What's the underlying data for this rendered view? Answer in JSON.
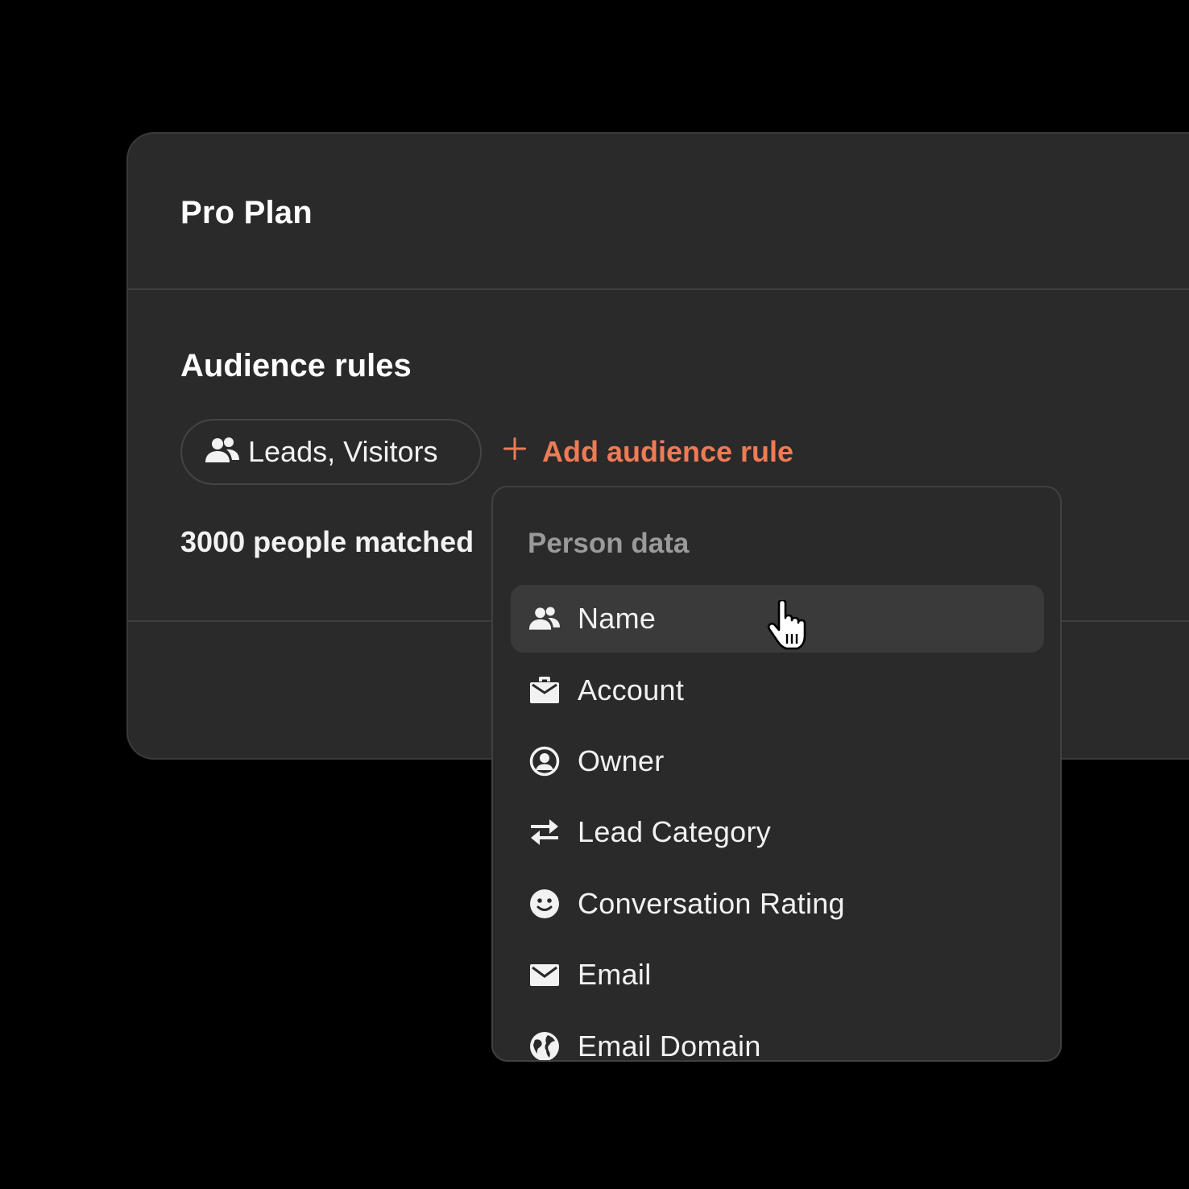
{
  "card": {
    "title": "Pro Plan",
    "section_title": "Audience rules",
    "audience_chip": {
      "icon": "people-icon",
      "label": "Leads, Visitors"
    },
    "add_rule_label": "Add audience rule",
    "matched_text": "3000 people matched"
  },
  "dropdown": {
    "header": "Person data",
    "items": [
      {
        "label": "Name",
        "icon": "people-icon",
        "active": true
      },
      {
        "label": "Account",
        "icon": "briefcase-icon",
        "active": false
      },
      {
        "label": "Owner",
        "icon": "user-circle-icon",
        "active": false
      },
      {
        "label": "Lead Category",
        "icon": "swap-arrows-icon",
        "active": false
      },
      {
        "label": "Conversation Rating",
        "icon": "smiley-icon",
        "active": false
      },
      {
        "label": "Email",
        "icon": "envelope-icon",
        "active": false
      },
      {
        "label": "Email Domain",
        "icon": "globe-icon",
        "active": false
      }
    ]
  },
  "colors": {
    "background": "#000000",
    "card": "#2a2a2a",
    "accent": "#ee7b56",
    "muted_text": "#9a9a9a",
    "active_row": "#3a3a3a"
  }
}
